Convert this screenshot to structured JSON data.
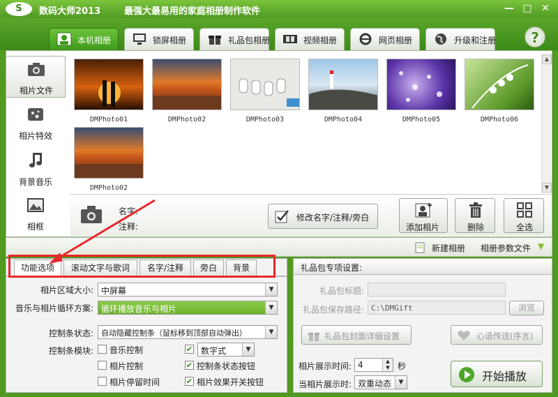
{
  "window": {
    "logo": "S",
    "app_name": "数码大师2013",
    "slogan": "最强大最易用的家庭相册制作软件"
  },
  "top_tabs": [
    {
      "label": "本机相册",
      "icon": "person-icon",
      "active": true
    },
    {
      "label": "锁屏相册",
      "icon": "monitor-icon"
    },
    {
      "label": "礼品包相册",
      "icon": "gift-icon"
    },
    {
      "label": "视频相册",
      "icon": "film-icon"
    },
    {
      "label": "网页相册",
      "icon": "ie-icon"
    },
    {
      "label": "升级和注册",
      "icon": "globe-icon"
    }
  ],
  "help_label": "?",
  "left_nav": [
    {
      "label": "相片文件",
      "icon": "camera-icon",
      "active": true
    },
    {
      "label": "相片特效",
      "icon": "sparkle-icon"
    },
    {
      "label": "背景音乐",
      "icon": "music-note-icon"
    },
    {
      "label": "相框",
      "icon": "picture-frame-icon"
    }
  ],
  "photos": [
    {
      "caption": "DMPhoto01"
    },
    {
      "caption": "DMPhoto02"
    },
    {
      "caption": "DMPhoto03"
    },
    {
      "caption": "DMPhoto04"
    },
    {
      "caption": "DMPhoto05"
    },
    {
      "caption": "DMPhoto06"
    },
    {
      "caption": "DMPhoto02"
    }
  ],
  "info": {
    "name_label": "名字:",
    "note_label": "注释:",
    "edit_button": "修改名字/注释/旁白",
    "add_button": "添加相片",
    "delete_button": "删除",
    "select_all_button": "全选"
  },
  "subbar": {
    "new_album": "新建相册",
    "album_params": "相册参数文件"
  },
  "sub_tabs": [
    "功能选项",
    "滚动文字与歌词",
    "名字/注释",
    "旁白",
    "背景"
  ],
  "options": {
    "area_size_label": "相片区域大小:",
    "area_size_value": "中屏幕",
    "loop_label": "音乐与相片循环方案:",
    "loop_value": "循环播放音乐与相片",
    "control_state_label": "控制条状态:",
    "control_state_value": "自动隐藏控制条（鼠标移到顶部自动弹出）",
    "control_module_label": "控制条模块:",
    "checkboxes": [
      {
        "label": "音乐控制",
        "checked": false
      },
      {
        "label": "相片控制",
        "checked": false
      },
      {
        "label": "相片停留时间",
        "checked": false
      },
      {
        "label": "",
        "checked": true
      },
      {
        "label": "控制条状态按钮",
        "checked": true
      },
      {
        "label": "相片效果开关按钮",
        "checked": true
      }
    ],
    "digital_select": "数字式"
  },
  "gift": {
    "header": "礼品包专项设置:",
    "title_label": "礼品包标题:",
    "title_value": "",
    "save_path_label": "礼品包保存路径:",
    "save_path_value": "C:\\DMGift",
    "browse_button": "浏览",
    "cover_button": "礼品包封面详细设置",
    "heart_button": "心语传送(序言)"
  },
  "display": {
    "time_label": "相片展示时间:",
    "time_value": "4",
    "time_unit": "秒",
    "when_label": "当相片展示时:",
    "when_value": "双重动态"
  },
  "start_button": "开始播放"
}
